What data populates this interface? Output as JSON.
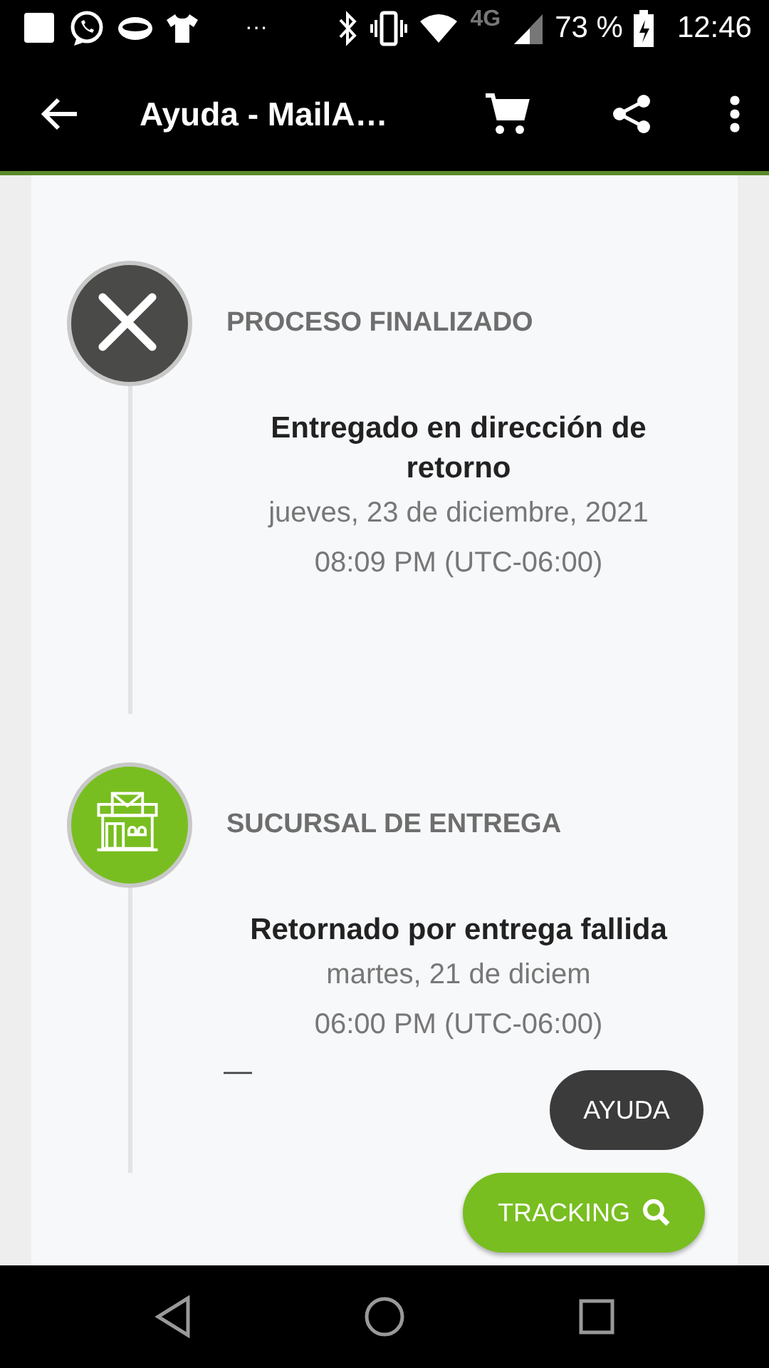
{
  "status_bar": {
    "overflow": "···",
    "network": "4G",
    "battery": "73 %",
    "time": "12:46"
  },
  "app_bar": {
    "title": "Ayuda - MailA…"
  },
  "timeline": [
    {
      "kind": "cancelled",
      "status": "PROCESO FINALIZADO",
      "description": "Entregado en dirección de retorno",
      "date": "jueves, 23 de diciembre, 2021",
      "time": "08:09 PM (UTC-06:00)"
    },
    {
      "kind": "branch",
      "status": "SUCURSAL DE ENTREGA",
      "description": "Retornado por entrega fallida",
      "date": "martes, 21 de diciem",
      "time": "06:00 PM (UTC-06:00)",
      "extra": "—"
    }
  ],
  "floating_buttons": [
    {
      "kind": "dark",
      "label": "AYUDA"
    },
    {
      "kind": "green",
      "label": "TRACKING"
    }
  ]
}
